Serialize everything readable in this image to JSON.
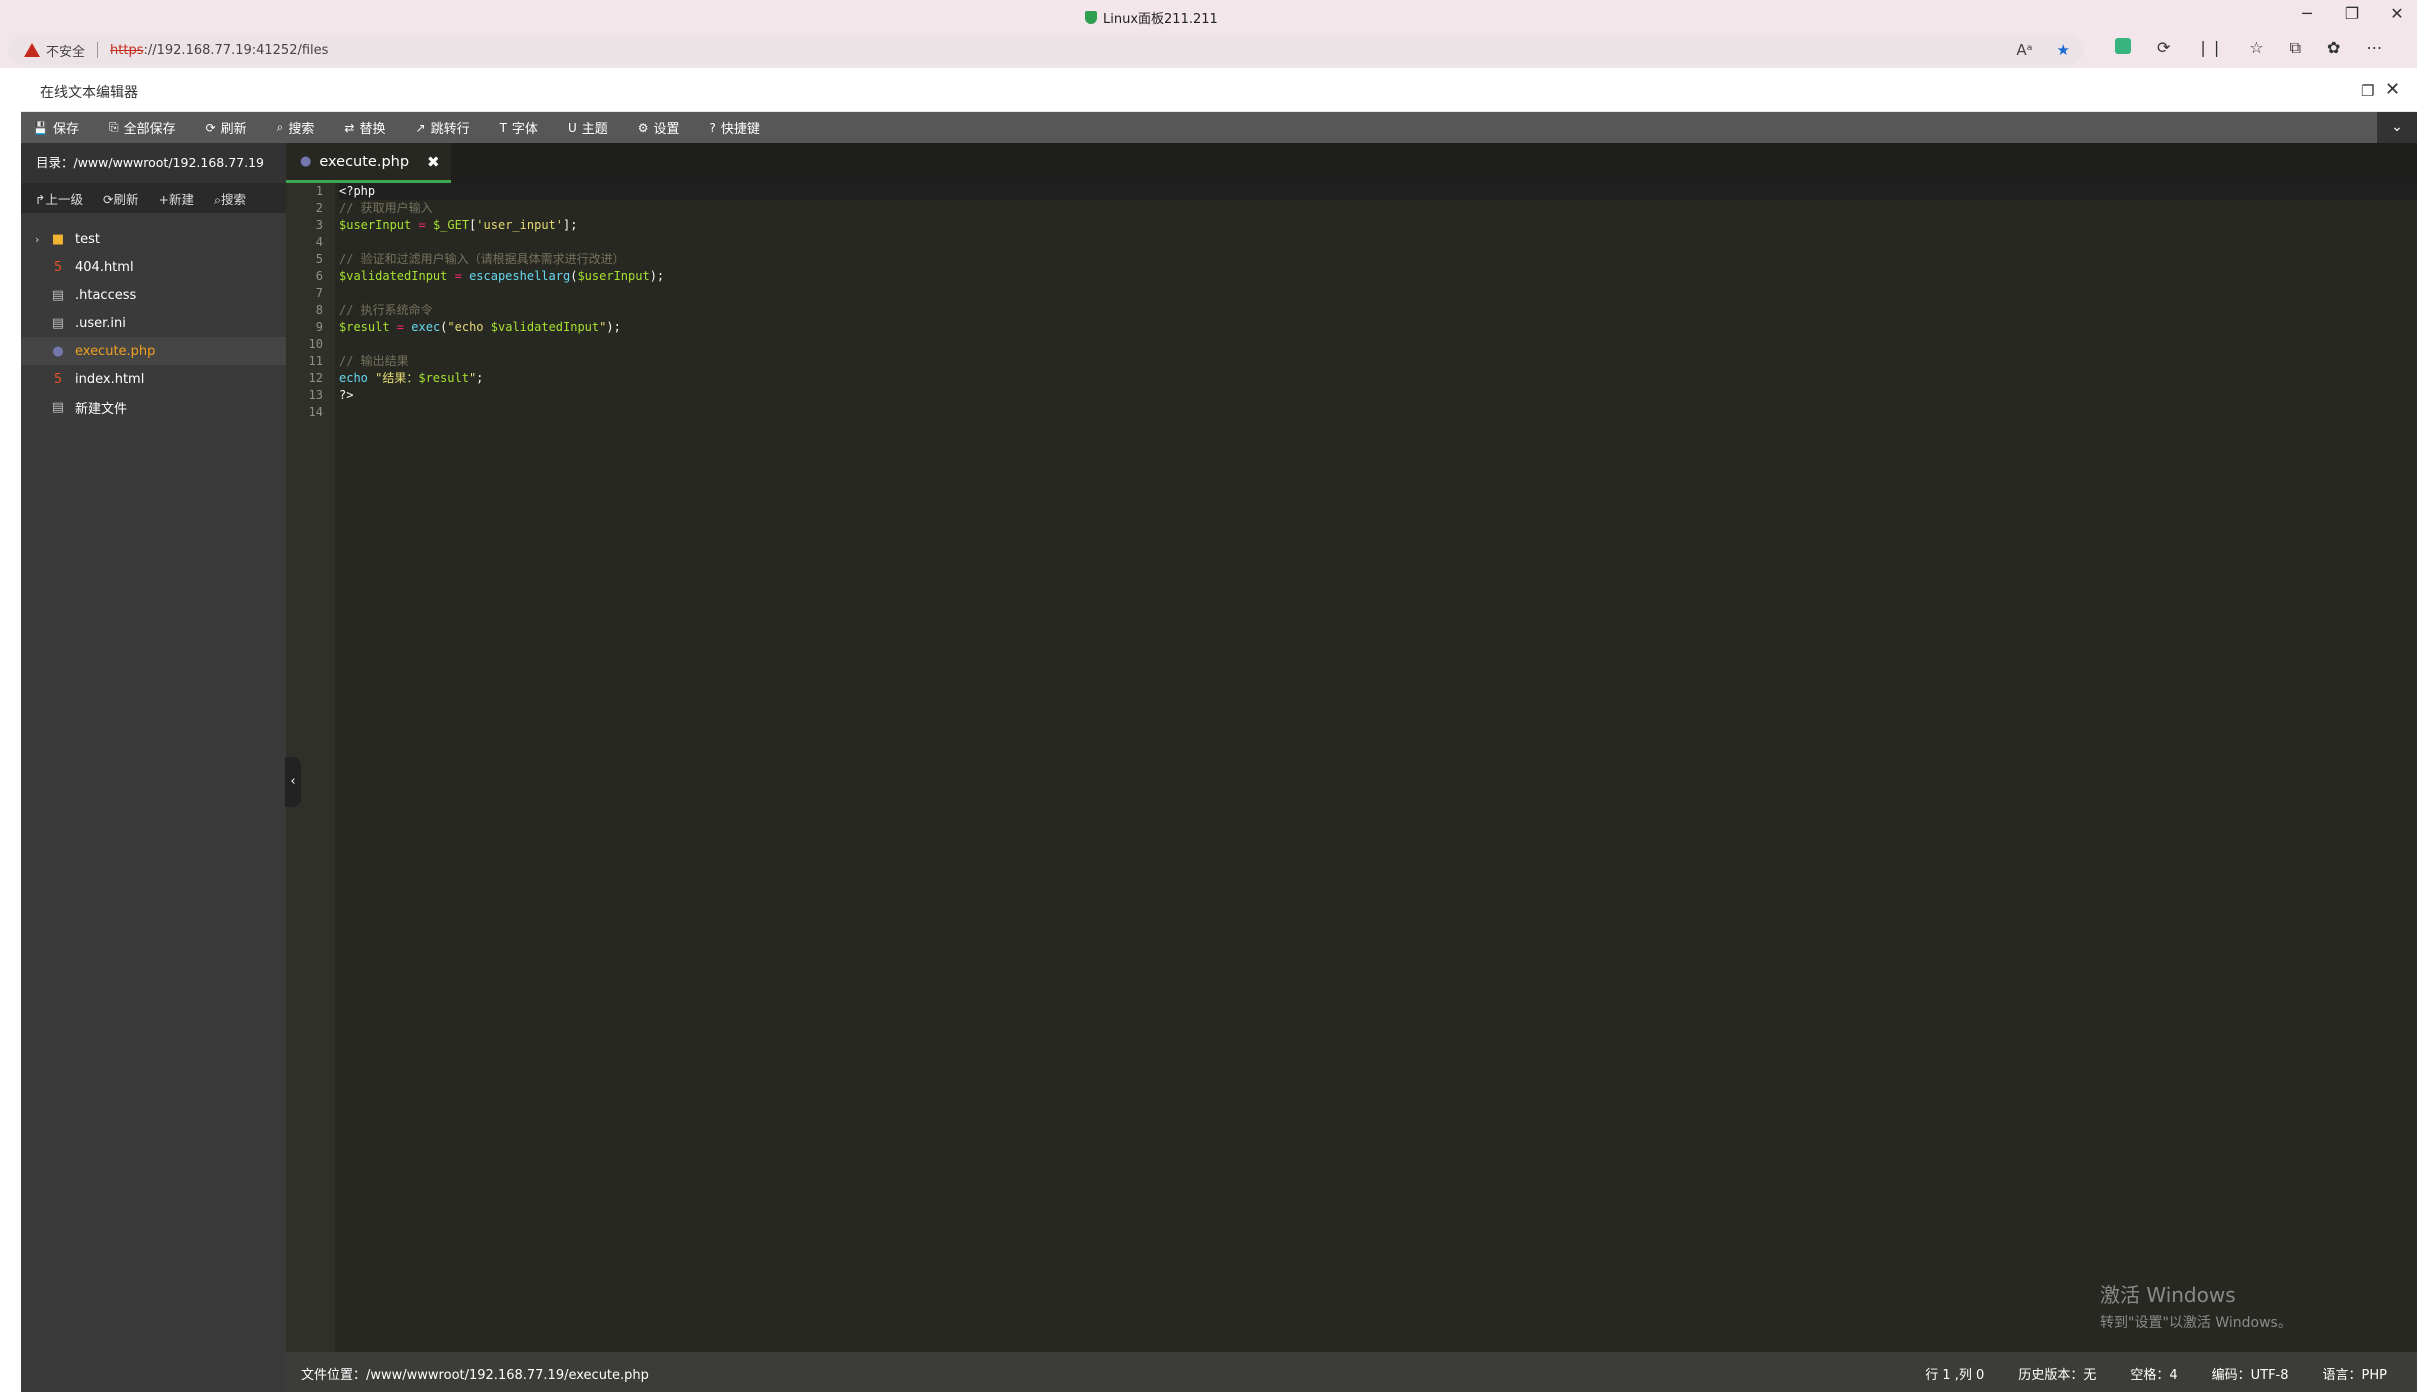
{
  "browser": {
    "window_title": "Linux面板211.211",
    "window_controls": {
      "minimize": "─",
      "restore": "❐",
      "close": "✕"
    },
    "security_label": "不安全",
    "url_scheme": "https",
    "url_rest": "://192.168.77.19:41252/files",
    "addr_icons": [
      "Aᵃ",
      "★"
    ],
    "toolbar_icons": [
      "⟳",
      "❘❘",
      "☆",
      "⧉",
      "✿",
      "⋯"
    ]
  },
  "dialog": {
    "title": "在线文本编辑器",
    "max_icon": "❐",
    "close_icon": "✕"
  },
  "toolbar": [
    {
      "icon": "💾",
      "label": "保存"
    },
    {
      "icon": "⎘",
      "label": "全部保存"
    },
    {
      "icon": "⟳",
      "label": "刷新"
    },
    {
      "icon": "⌕",
      "label": "搜索"
    },
    {
      "icon": "⇄",
      "label": "替换"
    },
    {
      "icon": "↗",
      "label": "跳转行"
    },
    {
      "icon": "T",
      "label": "字体"
    },
    {
      "icon": "U",
      "label": "主题"
    },
    {
      "icon": "⚙",
      "label": "设置"
    },
    {
      "icon": "?",
      "label": "快捷键"
    }
  ],
  "sidebar": {
    "dir_label": "目录：/www/wwwroot/192.168.77.19",
    "tools": [
      {
        "icon": "↱",
        "label": "上一级"
      },
      {
        "icon": "⟳",
        "label": "刷新"
      },
      {
        "icon": "+",
        "label": "新建"
      },
      {
        "icon": "⌕",
        "label": "搜索"
      }
    ],
    "files": [
      {
        "name": "test",
        "type": "folder"
      },
      {
        "name": "404.html",
        "type": "html"
      },
      {
        "name": ".htaccess",
        "type": "text"
      },
      {
        "name": ".user.ini",
        "type": "text"
      },
      {
        "name": "execute.php",
        "type": "php"
      },
      {
        "name": "index.html",
        "type": "html"
      },
      {
        "name": "新建文件",
        "type": "text"
      }
    ]
  },
  "editor": {
    "tab_name": "execute.php",
    "tab_close": "✖",
    "line_numbers": [
      "1",
      "2",
      "3",
      "4",
      "5",
      "6",
      "7",
      "8",
      "9",
      "10",
      "11",
      "12",
      "13",
      "14"
    ],
    "code": {
      "l1": "<?php",
      "l2": "// 获取用户输入",
      "l3_var": "$userInput",
      "l3_op": " = ",
      "l3_get": "$_GET",
      "l3_open": "[",
      "l3_str": "'user_input'",
      "l3_close": "];",
      "l4": "",
      "l5": "// 验证和过滤用户输入（请根据具体需求进行改进）",
      "l6_var": "$validatedInput",
      "l6_op": " = ",
      "l6_fn": "escapeshellarg",
      "l6_open": "(",
      "l6_arg": "$userInput",
      "l6_close": ");",
      "l7": "",
      "l8": "// 执行系统命令",
      "l9_var": "$result",
      "l9_op": " = ",
      "l9_fn": "exec",
      "l9_open": "(",
      "l9_str1": "\"echo ",
      "l9_arg": "$validatedInput",
      "l9_str2": "\"",
      "l9_close": ");",
      "l10": "",
      "l11": "// 输出结果",
      "l12_kw": "echo",
      "l12_str1": " \"结果：",
      "l12_arg": "$result",
      "l12_str2": "\"",
      "l12_end": ";",
      "l13": "?>",
      "l14": ""
    },
    "status": {
      "path": "文件位置：/www/wwwroot/192.168.77.19/execute.php",
      "cursor": "行 1 ,列 0",
      "history": "历史版本：无",
      "spaces": "空格：4",
      "encoding": "编码：UTF-8",
      "language": "语言：PHP"
    }
  },
  "collapse_handle": "‹",
  "watermark": {
    "line1": "激活 Windows",
    "line2": "转到\"设置\"以激活 Windows。"
  }
}
